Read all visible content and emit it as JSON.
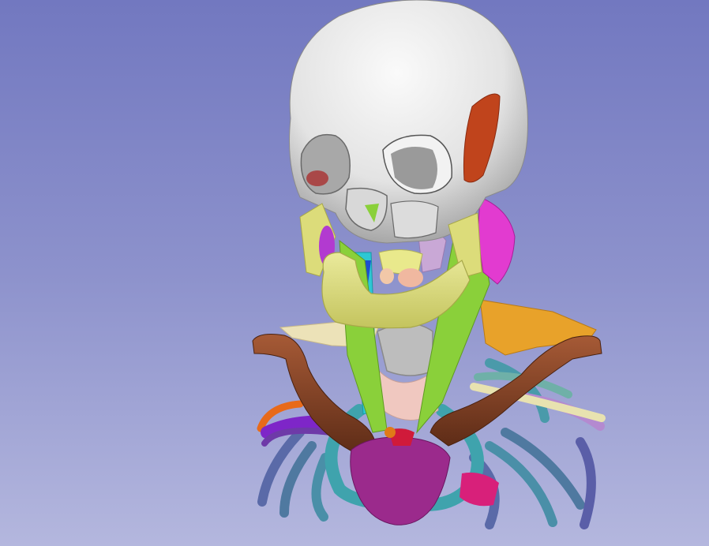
{
  "scene": {
    "background_top": "#7278c0",
    "background_bottom": "#b4b7de",
    "structures": [
      {
        "name": "skull",
        "color": "#ececec"
      },
      {
        "name": "mandible",
        "color": "#dcdc7a"
      },
      {
        "name": "hyoid",
        "color": "#e9e98c"
      },
      {
        "name": "clavicle-left",
        "color": "#7a3e24"
      },
      {
        "name": "clavicle-right",
        "color": "#7a3e24"
      },
      {
        "name": "sternum-manubrium",
        "color": "#9b2a8c"
      },
      {
        "name": "trachea",
        "color": "#bdbdbd"
      },
      {
        "name": "common-carotid-artery",
        "color": "#2ec7d4"
      },
      {
        "name": "sternocleidomastoid-muscle",
        "color": "#8ad03a"
      },
      {
        "name": "parotid-gland",
        "color": "#e23bd0"
      },
      {
        "name": "scapula",
        "color": "#e8a22a"
      },
      {
        "name": "ribs",
        "color": "#4a8fa8"
      },
      {
        "name": "subclavian-artery",
        "color": "#7e26c8"
      },
      {
        "name": "thyroid-gland",
        "color": "#f0b0b6"
      },
      {
        "name": "temporal-bone-segment",
        "color": "#c0441c"
      }
    ]
  }
}
